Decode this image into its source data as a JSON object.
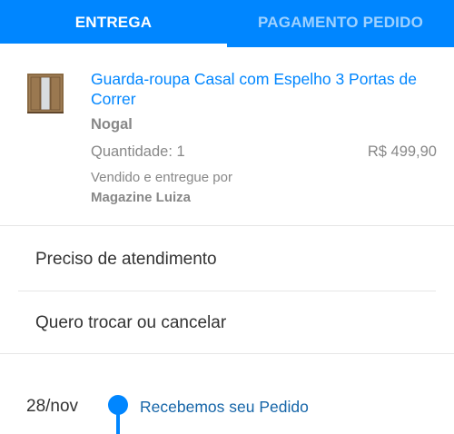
{
  "tabs": {
    "delivery_label": "ENTREGA",
    "payment_label": "PAGAMENTO PEDIDO"
  },
  "product": {
    "title": "Guarda-roupa Casal com Espelho 3 Portas de Correr",
    "variant": "Nogal",
    "quantity": "Quantidade: 1",
    "price": "R$ 499,90",
    "seller_label": "Vendido e entregue por",
    "seller_name": "Magazine Luiza",
    "image": "wardrobe-thumbnail"
  },
  "menu": {
    "support_label": "Preciso de atendimento",
    "exchange_label": "Quero trocar ou cancelar"
  },
  "timeline": {
    "date": "28/nov",
    "status": "Recebemos seu Pedido"
  },
  "colors": {
    "brand_blue": "#0086ff",
    "status_blue": "#1565a8"
  }
}
